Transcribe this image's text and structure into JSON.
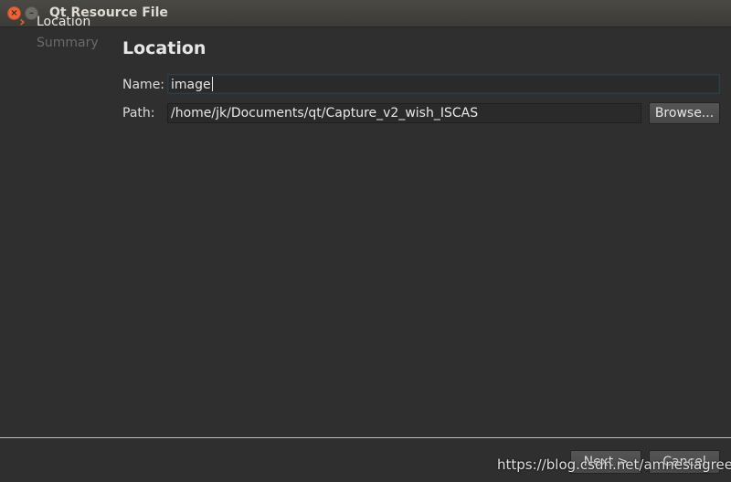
{
  "window": {
    "title": "Qt Resource File"
  },
  "sidebar": {
    "steps": [
      "Location",
      "Summary"
    ]
  },
  "page": {
    "heading": "Location"
  },
  "form": {
    "name_label": "Name:",
    "name_value": "image",
    "path_label": "Path:",
    "path_value": "/home/jk/Documents/qt/Capture_v2_wish_ISCAS",
    "browse_label": "Browse..."
  },
  "footer": {
    "next_label": "Next >",
    "cancel_label": "Cancel"
  },
  "watermark": "https://blog.csdn.net/amnesiagreen",
  "colors": {
    "accent": "#e9642f",
    "background": "#2f2f2f"
  }
}
